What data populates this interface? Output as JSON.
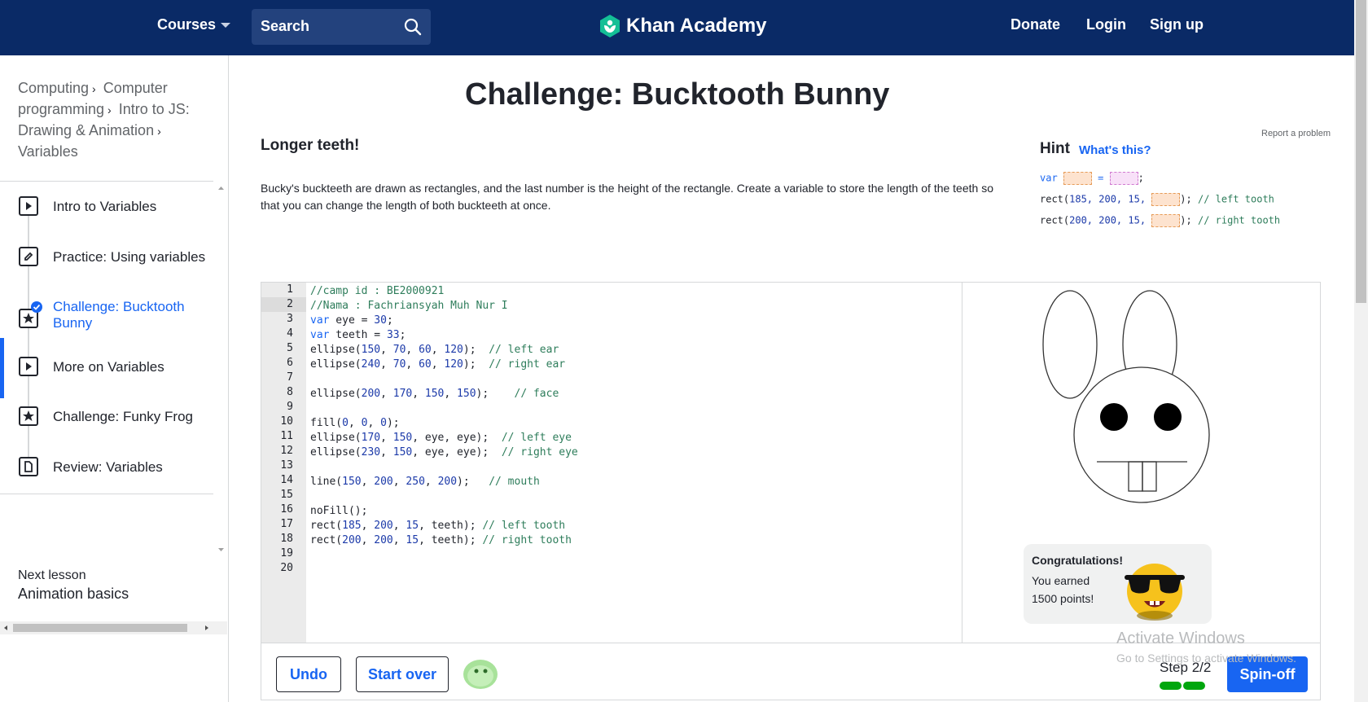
{
  "header": {
    "courses_label": "Courses",
    "search_label": "Search",
    "brand_name": "Khan Academy",
    "donate_label": "Donate",
    "login_label": "Login",
    "signup_label": "Sign up"
  },
  "breadcrumb": {
    "items": [
      "Computing",
      "Computer programming",
      "Intro to JS: Drawing & Animation",
      "Variables"
    ]
  },
  "sidebar": {
    "items": [
      {
        "label": "Intro to Variables",
        "icon": "play-icon"
      },
      {
        "label": "Practice: Using variables",
        "icon": "pencil-icon"
      },
      {
        "label": "Challenge: Bucktooth Bunny",
        "icon": "star-icon",
        "active": true,
        "completed": true
      },
      {
        "label": "More on Variables",
        "icon": "play-icon"
      },
      {
        "label": "Challenge: Funky Frog",
        "icon": "star-icon"
      },
      {
        "label": "Review: Variables",
        "icon": "document-icon"
      }
    ],
    "next_lesson_label": "Next lesson",
    "next_lesson_title": "Animation basics"
  },
  "page": {
    "title": "Challenge: Bucktooth Bunny",
    "step_title": "Longer teeth!",
    "description": "Bucky's buckteeth are drawn as rectangles, and the last number is the height of the rectangle. Create a variable to store the length of the teeth so that you can change the length of both buckteeth at once.",
    "report_label": "Report a problem"
  },
  "hint": {
    "title": "Hint",
    "whats_this": "What's this?",
    "line1_kw": "var",
    "line1_eq": "=",
    "line1_end": ";",
    "line2_pre": "rect(",
    "line2_args": "185, 200, 15,",
    "line2_post": ");",
    "line2_comment": "// left tooth",
    "line3_pre": "rect(",
    "line3_args": "200, 200, 15,",
    "line3_post": ");",
    "line3_comment": "// right tooth"
  },
  "editor": {
    "line_numbers": [
      "1",
      "2",
      "3",
      "4",
      "5",
      "6",
      "7",
      "8",
      "9",
      "10",
      "11",
      "12",
      "13",
      "14",
      "15",
      "16",
      "17",
      "18",
      "19",
      "20"
    ],
    "lines": [
      "//camp id : BE2000921",
      "//Nama : Fachriansyah Muh Nur I",
      "var eye = 30;",
      "var teeth = 33;",
      "ellipse(150, 70, 60, 120);  // left ear",
      "ellipse(240, 70, 60, 120);  // right ear",
      "",
      "ellipse(200, 170, 150, 150);    // face",
      "",
      "fill(0, 0, 0);",
      "ellipse(170, 150, eye, eye);  // left eye",
      "ellipse(230, 150, eye, eye);  // right eye",
      "",
      "line(150, 200, 250, 200);   // mouth",
      "",
      "noFill();",
      "rect(185, 200, 15, teeth); // left tooth",
      "rect(200, 200, 15, teeth); // right tooth",
      "",
      ""
    ],
    "current_line": 2
  },
  "toolbar": {
    "undo_label": "Undo",
    "start_over_label": "Start over",
    "step_label": "Step 2/2",
    "spinoff_label": "Spin-off"
  },
  "congrats": {
    "title": "Congratulations!",
    "line1": "You earned",
    "line2": "1500 points!"
  },
  "watermark": {
    "line1": "Activate Windows",
    "line2": "Go to Settings to activate Windows."
  },
  "colors": {
    "header_bg": "#0a2a66",
    "accent": "#1865f2",
    "success": "#00a60e",
    "brand_green": "#14bf96"
  }
}
